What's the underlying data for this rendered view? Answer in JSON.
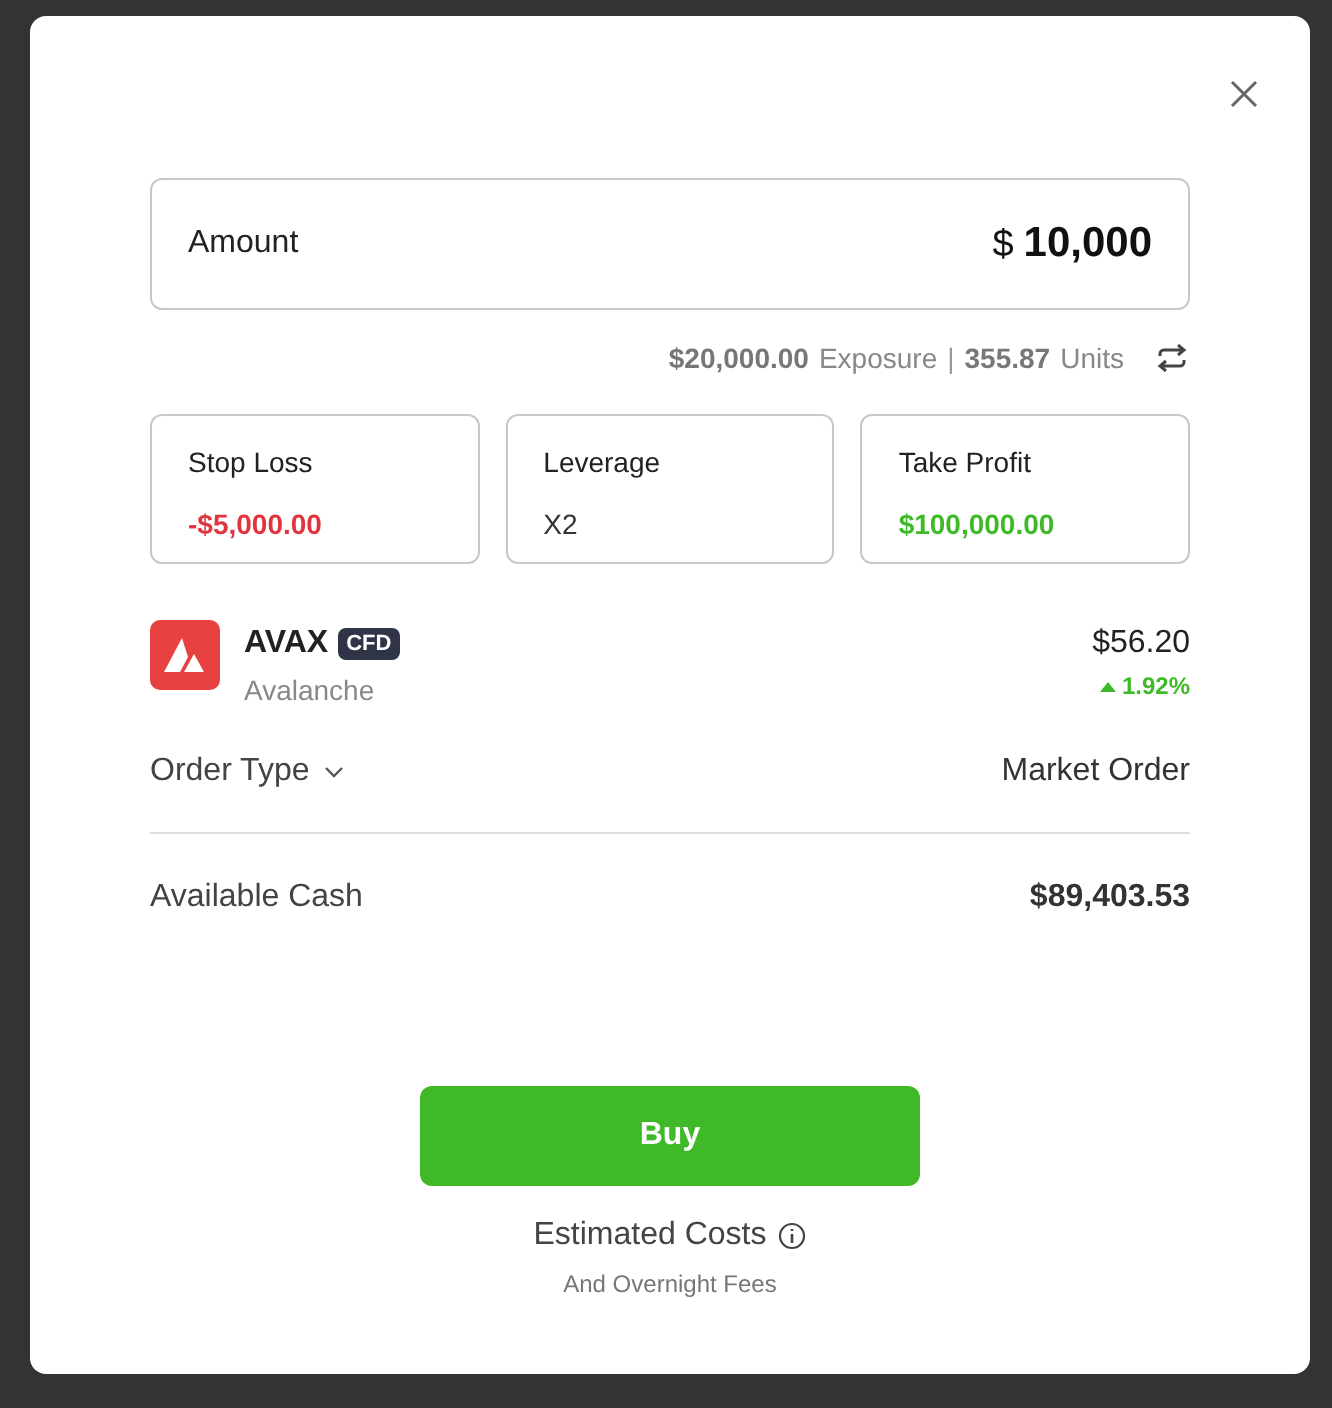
{
  "amount": {
    "label": "Amount",
    "currency": "$",
    "value": "10,000"
  },
  "exposure": {
    "exposure_value": "$20,000.00",
    "exposure_label": "Exposure",
    "separator": "|",
    "units_value": "355.87",
    "units_label": "Units"
  },
  "parameters": [
    {
      "label": "Stop Loss",
      "value": "-$5,000.00",
      "kind": "loss"
    },
    {
      "label": "Leverage",
      "value": "X2",
      "kind": "neutral"
    },
    {
      "label": "Take Profit",
      "value": "$100,000.00",
      "kind": "profit"
    }
  ],
  "instrument": {
    "symbol": "AVAX",
    "badge": "CFD",
    "name": "Avalanche",
    "price": "$56.20",
    "change": "1.92%",
    "rising": true
  },
  "order_type": {
    "label": "Order Type",
    "value": "Market Order"
  },
  "available_cash": {
    "label": "Available Cash",
    "value": "$89,403.53"
  },
  "buy_button": "Buy",
  "costs": {
    "label": "Estimated Costs",
    "note": "And Overnight Fees"
  }
}
